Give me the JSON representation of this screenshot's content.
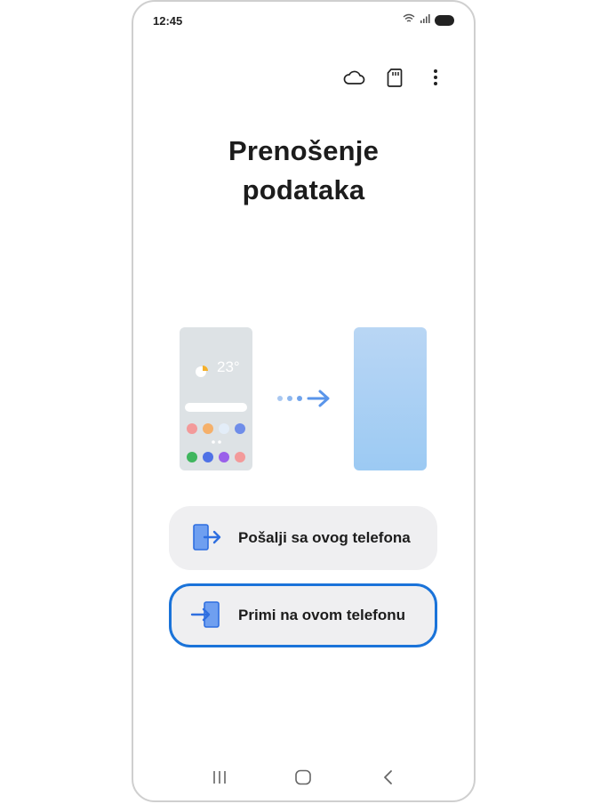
{
  "status_bar": {
    "time": "12:45"
  },
  "weather": {
    "temp": "23°"
  },
  "page": {
    "title_line1": "Prenošenje",
    "title_line2": "podataka"
  },
  "actions": {
    "send_label": "Pošalji sa ovog telefona",
    "receive_label": "Primi na ovom telefonu"
  },
  "colors": {
    "accent": "#1a73d9",
    "button_bg": "#efeff1",
    "icon_blue": "#3b7ae6"
  },
  "icons": {
    "toolbar": [
      "cloud-icon",
      "sd-card-icon",
      "more-options-icon"
    ],
    "navbar": [
      "recent-apps-icon",
      "home-icon",
      "back-icon"
    ]
  }
}
